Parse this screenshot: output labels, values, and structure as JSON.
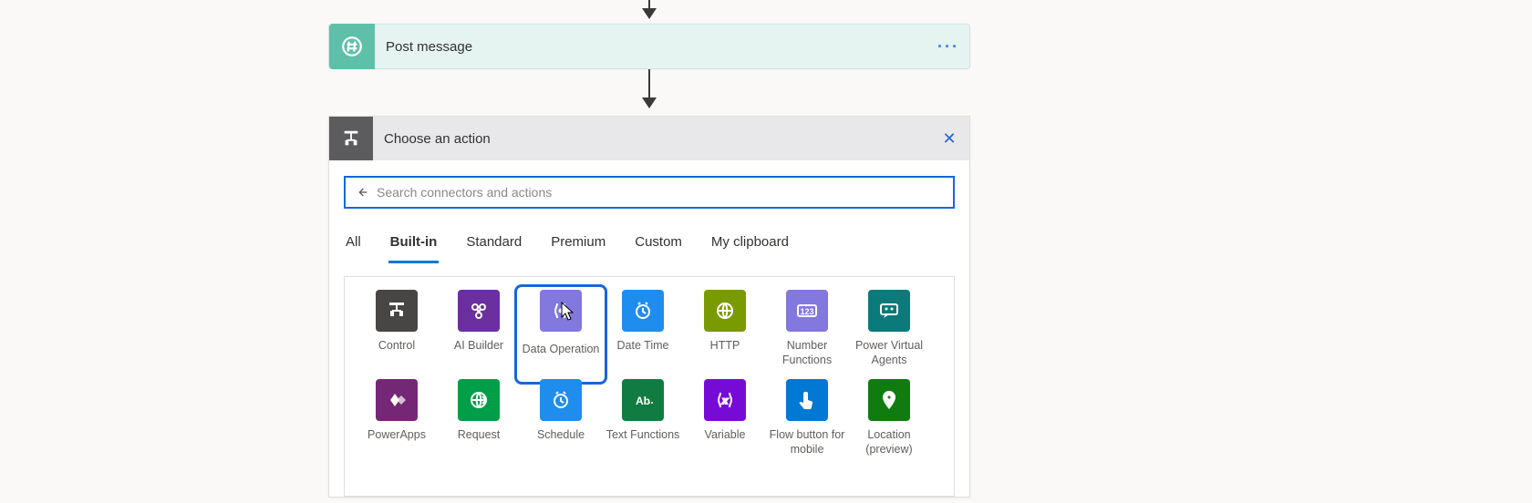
{
  "step": {
    "title": "Post message",
    "icon": "hashtag-icon",
    "menu_label": "···"
  },
  "panel": {
    "title": "Choose an action",
    "close_glyph": "✕",
    "search": {
      "placeholder": "Search connectors and actions",
      "value": ""
    }
  },
  "tabs": [
    {
      "id": "all",
      "label": "All",
      "active": false
    },
    {
      "id": "builtin",
      "label": "Built-in",
      "active": true
    },
    {
      "id": "standard",
      "label": "Standard",
      "active": false
    },
    {
      "id": "premium",
      "label": "Premium",
      "active": false
    },
    {
      "id": "custom",
      "label": "Custom",
      "active": false
    },
    {
      "id": "clipboard",
      "label": "My clipboard",
      "active": false
    }
  ],
  "connectors": [
    {
      "id": "control",
      "label": "Control",
      "color": "#484644",
      "glyph": "control"
    },
    {
      "id": "aibuilder",
      "label": "AI Builder",
      "color": "#6b2fa0",
      "glyph": "aibuilder"
    },
    {
      "id": "dataoperation",
      "label": "Data Operation",
      "color": "#8378de",
      "glyph": "dataop",
      "highlight": true
    },
    {
      "id": "datetime",
      "label": "Date Time",
      "color": "#1f8ded",
      "glyph": "clock"
    },
    {
      "id": "http",
      "label": "HTTP",
      "color": "#7a9a01",
      "glyph": "globe"
    },
    {
      "id": "numberfns",
      "label": "Number Functions",
      "color": "#8378de",
      "glyph": "123"
    },
    {
      "id": "pva",
      "label": "Power Virtual Agents",
      "color": "#0c7a7a",
      "glyph": "pva"
    },
    {
      "id": "powerapps",
      "label": "PowerApps",
      "color": "#742774",
      "glyph": "powerapps"
    },
    {
      "id": "request",
      "label": "Request",
      "color": "#009e49",
      "glyph": "request"
    },
    {
      "id": "schedule",
      "label": "Schedule",
      "color": "#1f8ded",
      "glyph": "clock"
    },
    {
      "id": "textfns",
      "label": "Text Functions",
      "color": "#107c41",
      "glyph": "abc"
    },
    {
      "id": "variable",
      "label": "Variable",
      "color": "#770bd6",
      "glyph": "var"
    },
    {
      "id": "flowbutton",
      "label": "Flow button for mobile",
      "color": "#0078d4",
      "glyph": "touch"
    },
    {
      "id": "location",
      "label": "Location (preview)",
      "color": "#107c10",
      "glyph": "pin"
    }
  ]
}
